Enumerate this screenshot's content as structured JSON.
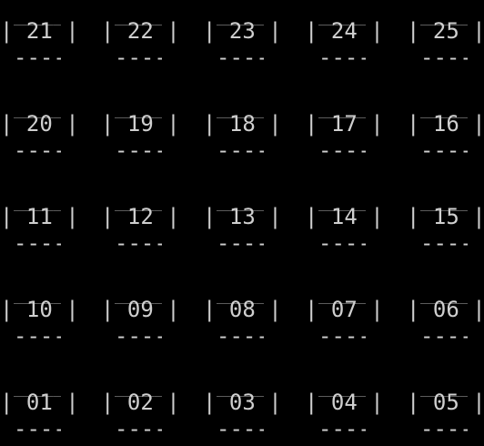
{
  "terminal": {
    "rows": [
      [
        "21",
        "22",
        "23",
        "24",
        "25"
      ],
      [
        "20",
        "19",
        "18",
        "17",
        "16"
      ],
      [
        "11",
        "12",
        "13",
        "14",
        "15"
      ],
      [
        "10",
        "09",
        "08",
        "07",
        "06"
      ],
      [
        "01",
        "02",
        "03",
        "04",
        "05"
      ]
    ],
    "cell_top": "____",
    "cell_bottom": "----",
    "cell_left": "|",
    "cell_right": "|"
  }
}
